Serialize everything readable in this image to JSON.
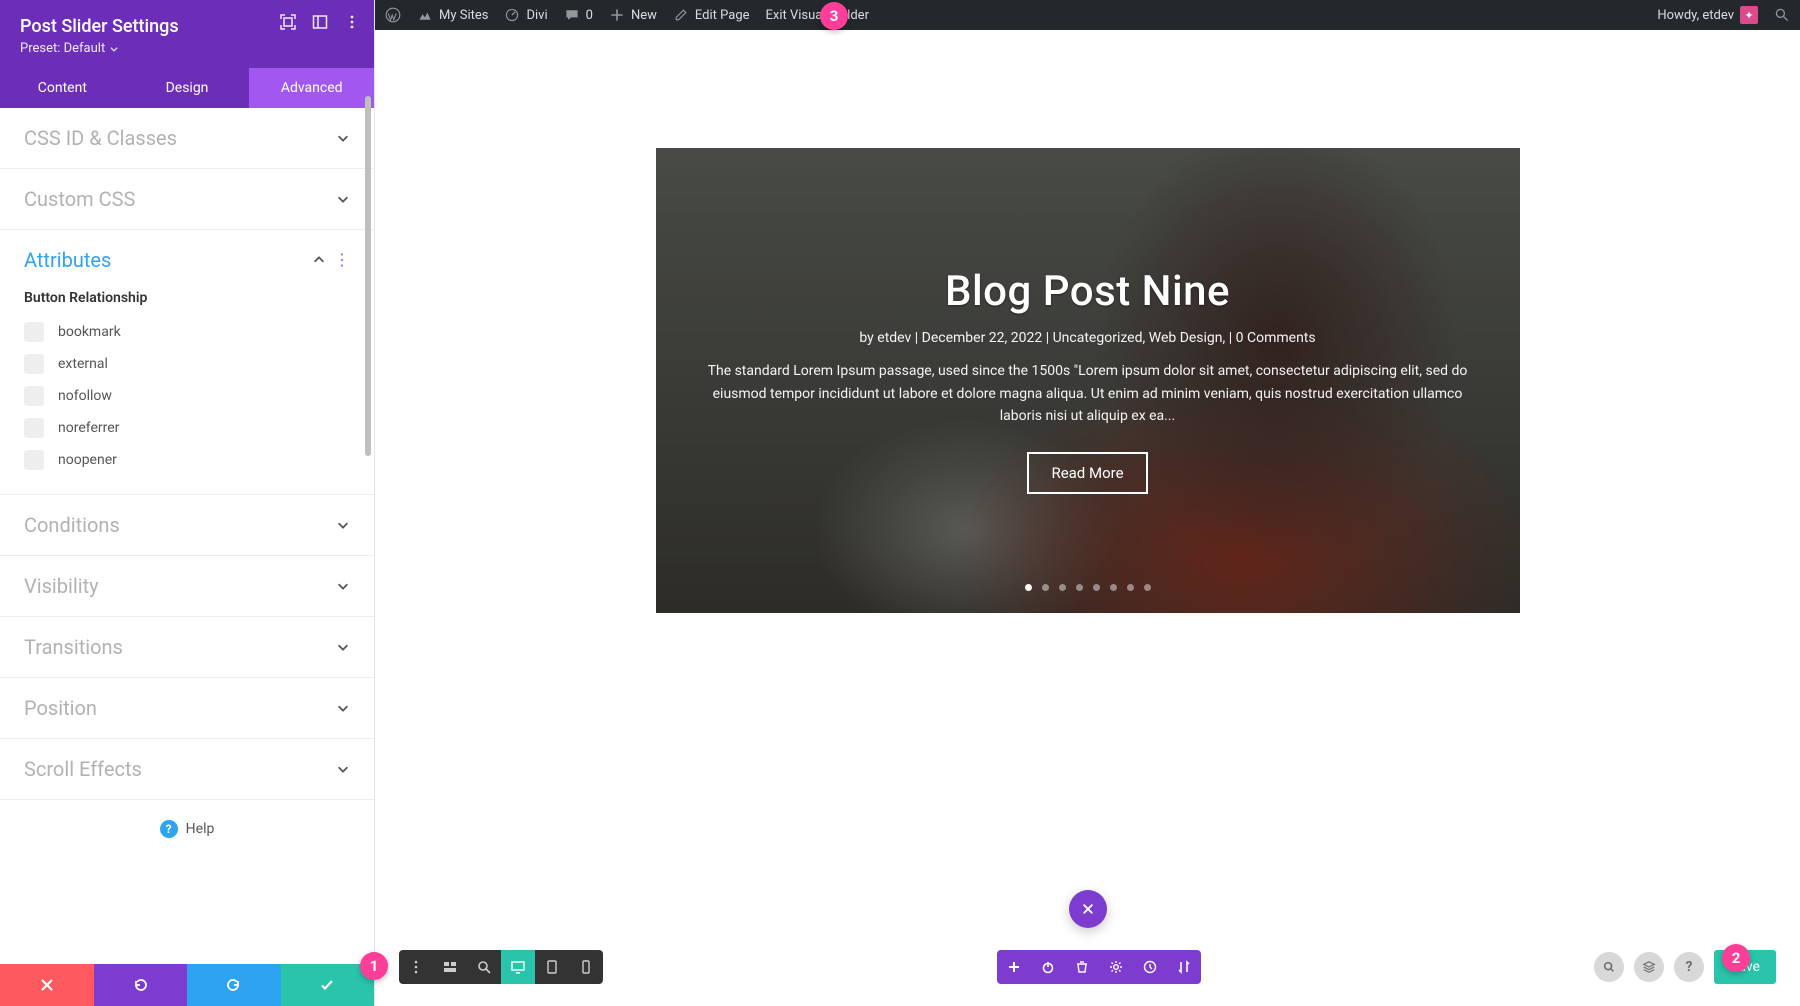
{
  "panel": {
    "title": "Post Slider Settings",
    "preset_label": "Preset: Default",
    "tabs": {
      "content": "Content",
      "design": "Design",
      "advanced": "Advanced"
    },
    "sections": {
      "css_id": {
        "title": "CSS ID & Classes"
      },
      "custom_css": {
        "title": "Custom CSS"
      },
      "attributes": {
        "title": "Attributes",
        "field_label": "Button Relationship",
        "options": [
          {
            "label": "bookmark"
          },
          {
            "label": "external"
          },
          {
            "label": "nofollow"
          },
          {
            "label": "noreferrer"
          },
          {
            "label": "noopener"
          }
        ]
      },
      "conditions": {
        "title": "Conditions"
      },
      "visibility": {
        "title": "Visibility"
      },
      "transitions": {
        "title": "Transitions"
      },
      "position": {
        "title": "Position"
      },
      "scroll_effects": {
        "title": "Scroll Effects"
      }
    },
    "help_label": "Help"
  },
  "adminbar": {
    "my_sites": "My Sites",
    "site_name": "Divi",
    "comments": "0",
    "new": "New",
    "edit_page": "Edit Page",
    "exit_visual_builder": "Exit Visual Builder",
    "howdy": "Howdy, etdev"
  },
  "slide": {
    "title": "Blog Post Nine",
    "meta": "by etdev | December 22, 2022 | Uncategorized, Web Design, | 0 Comments",
    "body": "The standard Lorem Ipsum passage, used since the 1500s \"Lorem ipsum dolor sit amet, consectetur adipiscing elit, sed do eiusmod tempor incididunt ut labore et dolore magna aliqua. Ut enim ad minim veniam, quis nostrud exercitation ullamco laboris nisi ut aliquip ex ea...",
    "button": "Read More",
    "dot_count": 8,
    "active_dot": 0
  },
  "bottom": {
    "save": "Save"
  },
  "annotations": {
    "one": "1",
    "two": "2",
    "three": "3"
  },
  "help_glyph": "?",
  "avatar_glyph": "✦"
}
